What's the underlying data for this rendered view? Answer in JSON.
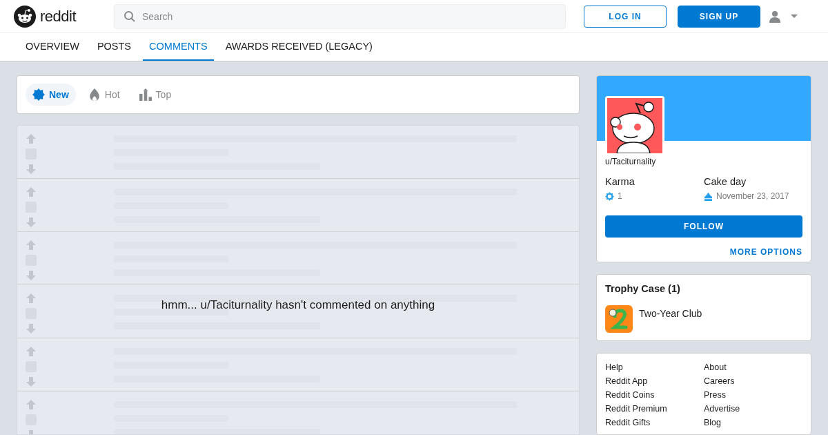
{
  "header": {
    "wordmark": "reddit",
    "search": {
      "placeholder": "Search"
    },
    "buttons": [
      {
        "label": "LOG IN",
        "kind": "outline"
      },
      {
        "label": "SIGN UP",
        "kind": "filled"
      }
    ]
  },
  "tabs": [
    {
      "label": "OVERVIEW",
      "selected": false
    },
    {
      "label": "POSTS",
      "selected": false
    },
    {
      "label": "COMMENTS",
      "selected": true
    },
    {
      "label": "AWARDS RECEIVED (LEGACY)",
      "selected": false
    }
  ],
  "sort_options": [
    {
      "label": "New",
      "kind": "new",
      "selected": true
    },
    {
      "label": "Hot",
      "kind": "hot",
      "selected": false
    },
    {
      "label": "Top",
      "kind": "top",
      "selected": false
    }
  ],
  "empty_message": "hmm... u/Taciturnality hasn't commented on anything",
  "profile": {
    "username": "u/Taciturnality",
    "stats": [
      {
        "label": "Karma",
        "value": "1",
        "kind": "karma"
      },
      {
        "label": "Cake day",
        "value": "November 23, 2017",
        "kind": "cakeday"
      }
    ],
    "follow_button": "FOLLOW",
    "more_options": "MORE OPTIONS"
  },
  "trophy_case": {
    "title": "Trophy Case (1)",
    "trophies": [
      {
        "name": "Two-Year Club"
      }
    ]
  },
  "footer_links": {
    "column_1": [
      "Help",
      "Reddit App",
      "Reddit Coins",
      "Reddit Premium",
      "Reddit Gifts"
    ],
    "column_2": [
      "About",
      "Careers",
      "Press",
      "Advertise",
      "Blog"
    ]
  }
}
